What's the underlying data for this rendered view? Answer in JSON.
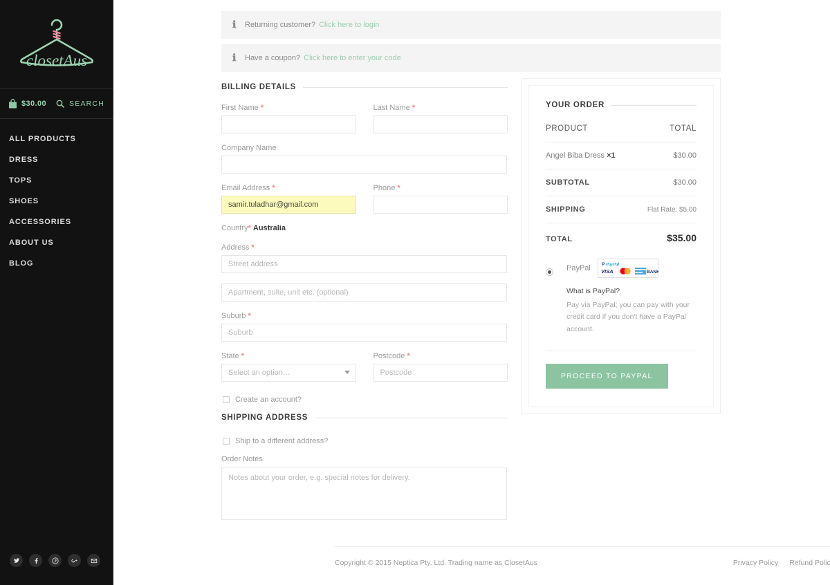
{
  "sidebar": {
    "logo": {
      "brand_text": "closetAus",
      "hanger_color": "#9bd3b1",
      "wrap_color": "#f2839f"
    },
    "cart": {
      "icon": "shopping-bag-icon",
      "amount": "$30.00"
    },
    "search": {
      "icon": "search-icon",
      "label": "SEARCH"
    },
    "nav_items": [
      {
        "label": "ALL PRODUCTS",
        "name": "all-products"
      },
      {
        "label": "DRESS",
        "name": "dress"
      },
      {
        "label": "TOPS",
        "name": "tops"
      },
      {
        "label": "SHOES",
        "name": "shoes"
      },
      {
        "label": "ACCESSORIES",
        "name": "accessories"
      },
      {
        "label": "ABOUT US",
        "name": "about-us"
      },
      {
        "label": "BLOG",
        "name": "blog"
      }
    ],
    "social": [
      {
        "name": "twitter-icon"
      },
      {
        "name": "facebook-icon"
      },
      {
        "name": "pinterest-icon"
      },
      {
        "name": "google-plus-icon"
      },
      {
        "name": "email-icon"
      }
    ]
  },
  "notices": {
    "login": {
      "icon": "info-icon",
      "text": "Returning customer?",
      "link": "Click here to login"
    },
    "coupon": {
      "icon": "info-icon",
      "text": "Have a coupon?",
      "link": "Click here to enter your code"
    }
  },
  "billing": {
    "heading": "BILLING DETAILS",
    "first_name": {
      "label": "First Name",
      "required": "*",
      "value": "",
      "placeholder": ""
    },
    "last_name": {
      "label": "Last Name",
      "required": "*",
      "value": "",
      "placeholder": ""
    },
    "company_name": {
      "label": "Company Name",
      "value": "",
      "placeholder": ""
    },
    "email": {
      "label": "Email Address",
      "required": "*",
      "value": "samir.tuladhar@gmail.com",
      "placeholder": ""
    },
    "phone": {
      "label": "Phone",
      "required": "*",
      "value": "",
      "placeholder": ""
    },
    "country": {
      "label": "Country",
      "required": "*",
      "value": "Australia"
    },
    "address": {
      "label": "Address",
      "required": "*",
      "placeholder": "Street address",
      "value": ""
    },
    "address2": {
      "placeholder": "Apartment, suite, unit etc. (optional)",
      "value": ""
    },
    "suburb": {
      "label": "Suburb",
      "required": "*",
      "placeholder": "Suburb",
      "value": ""
    },
    "state": {
      "label": "State",
      "required": "*",
      "selected": "Select an option…"
    },
    "postcode": {
      "label": "Postcode",
      "required": "*",
      "placeholder": "Postcode",
      "value": ""
    },
    "create_account": {
      "label": "Create an account?",
      "checked": false
    }
  },
  "shipping": {
    "heading": "SHIPPING ADDRESS",
    "different_address": {
      "label": "Ship to a different address?",
      "checked": false
    },
    "order_notes": {
      "label": "Order Notes",
      "placeholder": "Notes about your order, e.g. special notes for delivery.",
      "value": ""
    }
  },
  "order": {
    "heading": "YOUR ORDER",
    "col_product": "PRODUCT",
    "col_total": "TOTAL",
    "items": [
      {
        "name": "Angel Biba Dress",
        "qty_mark": "×",
        "qty": "1",
        "total": "$30.00"
      }
    ],
    "subtotal_label": "SUBTOTAL",
    "subtotal_value": "$30.00",
    "shipping_label": "SHIPPING",
    "shipping_value": "Flat Rate: $5.00",
    "total_label": "TOTAL",
    "total_value": "$35.00"
  },
  "payment": {
    "method_name": "PayPal",
    "selected": true,
    "logos": [
      "paypal-logo",
      "visa-logo",
      "mastercard-logo",
      "amex-logo",
      "bank-logo"
    ],
    "bank_label": "BANK",
    "visa_label": "VISA",
    "paypal_label": "PayPal",
    "question": "What is PayPal?",
    "description": "Pay via PayPal; you can pay with your credit card if you don't have a PayPal account.",
    "submit_label": "PROCEED TO PAYPAL",
    "accent_color": "#8cc4a1"
  },
  "footer": {
    "copyright": "Copyright © 2015 Neptica Pty. Ltd. Trading name as ClosetAus",
    "links": [
      {
        "label": "Privacy Policy"
      },
      {
        "label": "Refund Policy"
      }
    ]
  }
}
